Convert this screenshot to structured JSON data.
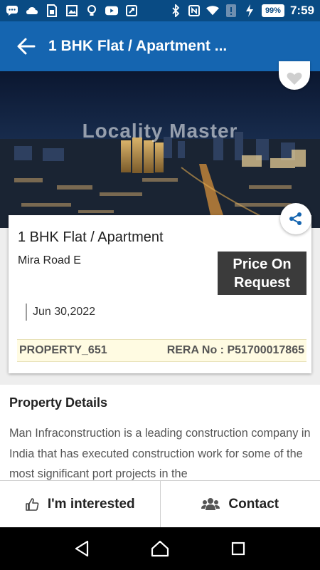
{
  "status_bar": {
    "battery": "99%",
    "time": "7:59",
    "icons": [
      "chat-icon",
      "cloud-icon",
      "sim-icon",
      "image-icon",
      "bulb-icon",
      "youtube-icon",
      "pad-icon",
      "bluetooth-icon",
      "nfc-icon",
      "wifi-icon",
      "alert-icon",
      "charging-icon"
    ]
  },
  "app_bar": {
    "title": "1 BHK Flat / Apartment ...",
    "back_icon": "arrow-left-icon"
  },
  "hero": {
    "watermark": "Locality Master",
    "favorite_icon": "heart-icon",
    "share_icon": "share-icon"
  },
  "property": {
    "title": "1 BHK Flat / Apartment",
    "locality": "Mira Road E",
    "price_line1": "Price On",
    "price_line2": "Request",
    "date": "Jun 30,2022",
    "property_id": "PROPERTY_651",
    "rera": "RERA No : P51700017865"
  },
  "details": {
    "heading": "Property Details",
    "description": "Man Infraconstruction is a leading construction company in India that has executed construction work for some of the most significant port projects in the"
  },
  "actions": {
    "interested_label": "I'm interested",
    "contact_label": "Contact"
  },
  "colors": {
    "status_bar": "#094b84",
    "app_bar": "#1565b0",
    "price_box": "#3b3b3b",
    "id_bar": "#fffbe2"
  }
}
